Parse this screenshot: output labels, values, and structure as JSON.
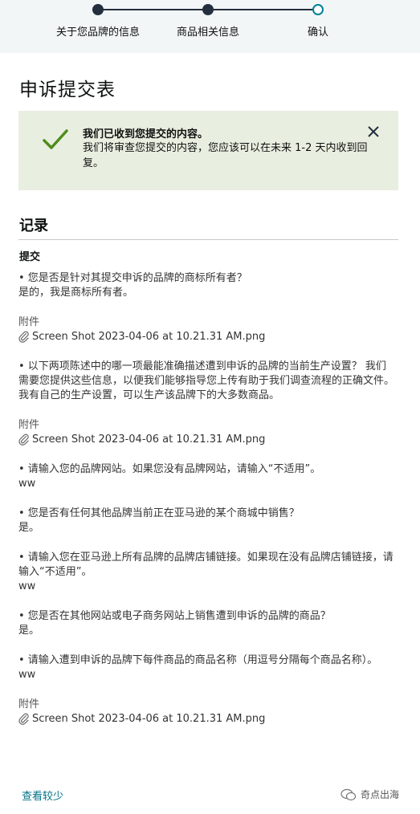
{
  "stepper": {
    "steps": [
      {
        "label": "关于您品牌的信息"
      },
      {
        "label": "商品相关信息"
      },
      {
        "label": "确认"
      }
    ]
  },
  "page_title": "申诉提交表",
  "alert": {
    "title": "我们已收到您提交的内容。",
    "body": "我们将审查您提交的内容，您应该可以在未来 1-2 天内收到回复。",
    "check_icon": "checkmark-icon",
    "close_icon": "close-icon"
  },
  "record": {
    "title": "记录",
    "section_title": "提交",
    "attachment_label": "附件",
    "items": [
      {
        "type": "qa",
        "q": "• 您是否是针对其提交申诉的品牌的商标所有者？",
        "a": "是的，我是商标所有者。"
      },
      {
        "type": "attach",
        "file": "Screen Shot 2023-04-06 at 10.21.31 AM.png"
      },
      {
        "type": "qa",
        "q": "• 以下两项陈述中的哪一项最能准确描述遭到申诉的品牌的当前生产设置？ 我们需要您提供这些信息，以便我们能够指导您上传有助于我们调查流程的正确文件。",
        "a": "我有自己的生产设置，可以生产该品牌下的大多数商品。"
      },
      {
        "type": "attach",
        "file": "Screen Shot 2023-04-06 at 10.21.31 AM.png"
      },
      {
        "type": "qa",
        "q": "• 请输入您的品牌网站。如果您没有品牌网站，请输入“不适用”。",
        "a": "ww"
      },
      {
        "type": "qa",
        "q": "• 您是否有任何其他品牌当前正在亚马逊的某个商城中销售？",
        "a": "是。"
      },
      {
        "type": "qa",
        "q": "• 请输入您在亚马逊上所有品牌的品牌店铺链接。如果现在没有品牌店铺链接，请输入“不适用”。",
        "a": "ww"
      },
      {
        "type": "qa",
        "q": "• 您是否在其他网站或电子商务网站上销售遭到申诉的品牌的商品？",
        "a": "是。"
      },
      {
        "type": "qa",
        "q": "• 请输入遭到申诉的品牌下每件商品的商品名称（用逗号分隔每个商品名称）。",
        "a": "ww"
      },
      {
        "type": "attach",
        "file": "Screen Shot 2023-04-06 at 10.21.31 AM.png"
      }
    ]
  },
  "show_less": "查看较少",
  "watermark": "奇点出海",
  "colors": {
    "accent": "#007185",
    "dark": "#232f3e",
    "success_bg": "#e9efe0",
    "check": "#4e8d1c",
    "step_current": "#008296"
  }
}
